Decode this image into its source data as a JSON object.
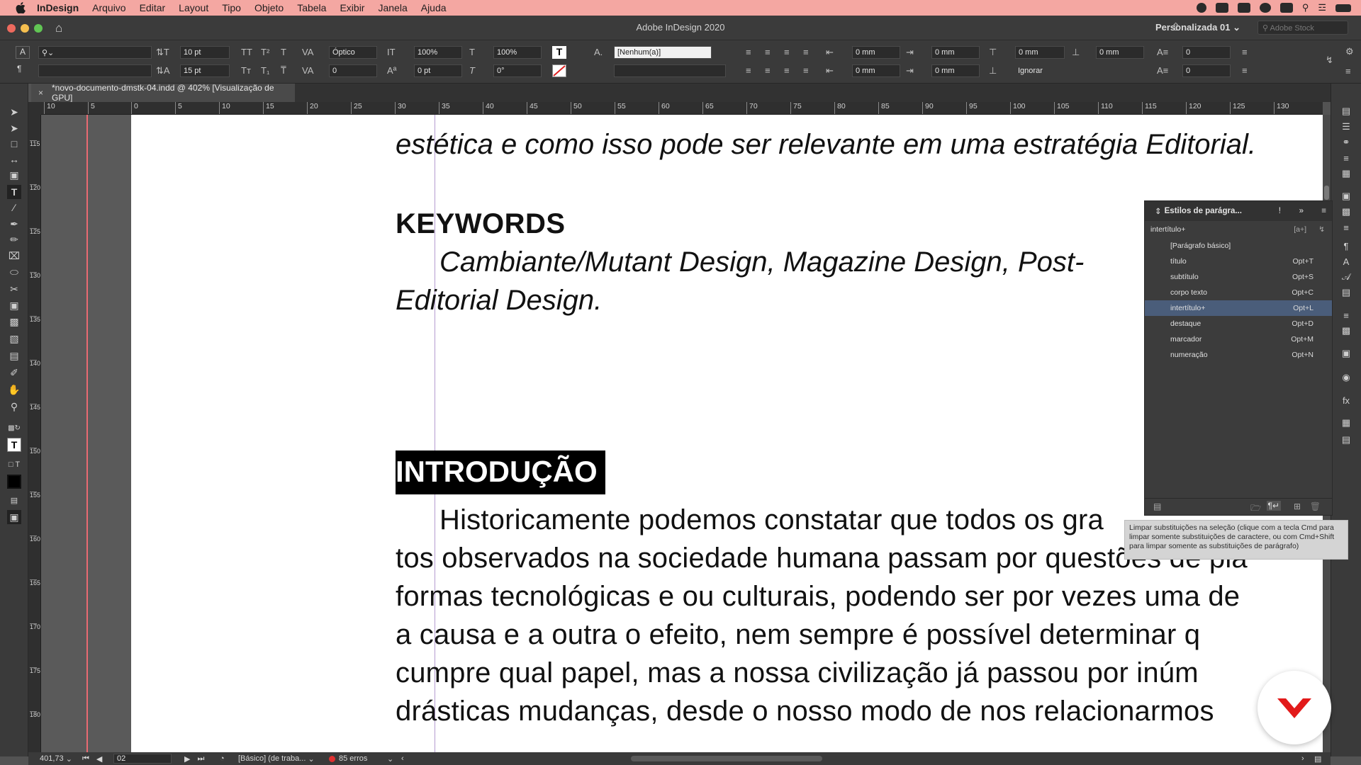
{
  "menubar": {
    "app": "InDesign",
    "items": [
      "Arquivo",
      "Editar",
      "Layout",
      "Tipo",
      "Objeto",
      "Tabela",
      "Exibir",
      "Janela",
      "Ajuda"
    ]
  },
  "window": {
    "title": "Adobe InDesign 2020",
    "workspace": "Personalizada 01",
    "stock_placeholder": "Adobe Stock"
  },
  "control": {
    "font_size": "10 pt",
    "leading": "15 pt",
    "kerning": "Óptico",
    "tracking": "0",
    "vscale": "100%",
    "hscale": "100%",
    "baseline": "0 pt",
    "skew": "0°",
    "char_style": "[Nenhum(a)]",
    "indent_left": "0 mm",
    "indent_first": "0 mm",
    "indent_right": "0 mm",
    "indent_last": "0 mm",
    "space_before": "0 mm",
    "space_after": "0 mm",
    "dropcap_lines": "0",
    "dropcap_chars": "0",
    "grid_align": "Ignorar"
  },
  "doc_tab": {
    "label": "*novo-documento-dmstk-04.indd @ 402% [Visualização de GPU]"
  },
  "ruler": {
    "labels": [
      "10",
      "5",
      "0",
      "5",
      "10",
      "15",
      "20",
      "25",
      "30",
      "35",
      "40",
      "45",
      "50",
      "55",
      "60",
      "65",
      "70",
      "75",
      "80",
      "85",
      "90",
      "95",
      "100",
      "105",
      "110",
      "115",
      "120",
      "125",
      "130"
    ],
    "vlabels": [
      "115",
      "120",
      "125",
      "130",
      "135",
      "140",
      "145",
      "150",
      "155",
      "160",
      "165",
      "170",
      "175",
      "180"
    ]
  },
  "document": {
    "line1": "estética e como isso pode ser relevante em uma estratégia Editorial.",
    "keywords_heading": "KEYWORDS",
    "keywords_line1": "Cambiante/Mutant Design, Magazine Design, Post-",
    "keywords_line2": "Editorial Design.",
    "intro_heading": "INTRODUÇÃO",
    "body": [
      "Historicamente podemos constatar que todos os gra",
      "tos observados na sociedade humana passam por questões de pla",
      "formas tecnológicas e ou culturais, podendo ser por vezes uma de",
      "a causa e a outra o efeito, nem sempre é possível determinar q",
      "cumpre qual papel, mas a nossa civilização já passou por inúm",
      "drásticas mudanças, desde o nosso modo de nos relacionarmos"
    ]
  },
  "paragraph_styles_panel": {
    "title": "Estilos de parágra...",
    "current": "intertítulo+",
    "styles": [
      {
        "name": "[Parágrafo básico]",
        "shortcut": ""
      },
      {
        "name": "título",
        "shortcut": "Opt+T"
      },
      {
        "name": "subtítulo",
        "shortcut": "Opt+S"
      },
      {
        "name": "corpo texto",
        "shortcut": "Opt+C"
      },
      {
        "name": "intertítulo+",
        "shortcut": "Opt+L",
        "selected": true
      },
      {
        "name": "destaque",
        "shortcut": "Opt+D"
      },
      {
        "name": "marcador",
        "shortcut": "Opt+M"
      },
      {
        "name": "numeração",
        "shortcut": "Opt+N"
      }
    ],
    "tooltip": "Limpar substituições na seleção (clique com a tecla Cmd para limpar somente substituições de caractere, ou com Cmd+Shift para limpar somente as substituições de parágrafo)"
  },
  "status": {
    "zoom": "401,73",
    "page": "02",
    "preflight_profile": "[Básico] (de traba...",
    "errors": "85 erros"
  },
  "colors": {
    "menubar": "#f4a7a2",
    "selected_style": "#4a5d7a",
    "brand": "#e21a1a"
  }
}
